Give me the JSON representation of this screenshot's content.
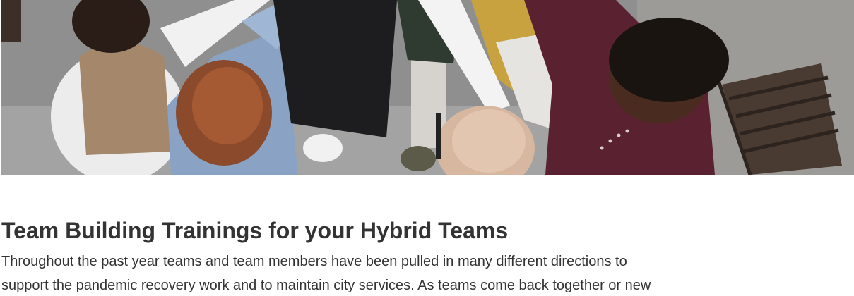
{
  "hero_image": {
    "alt": "Group of people raising hands together in a huddle"
  },
  "article": {
    "title": "Team Building Trainings for your Hybrid Teams",
    "body_lines": [
      "Throughout the past year teams and team members have been pulled in many different directions to",
      "support the pandemic recovery work and to maintain city services. As teams come back together or new"
    ]
  }
}
